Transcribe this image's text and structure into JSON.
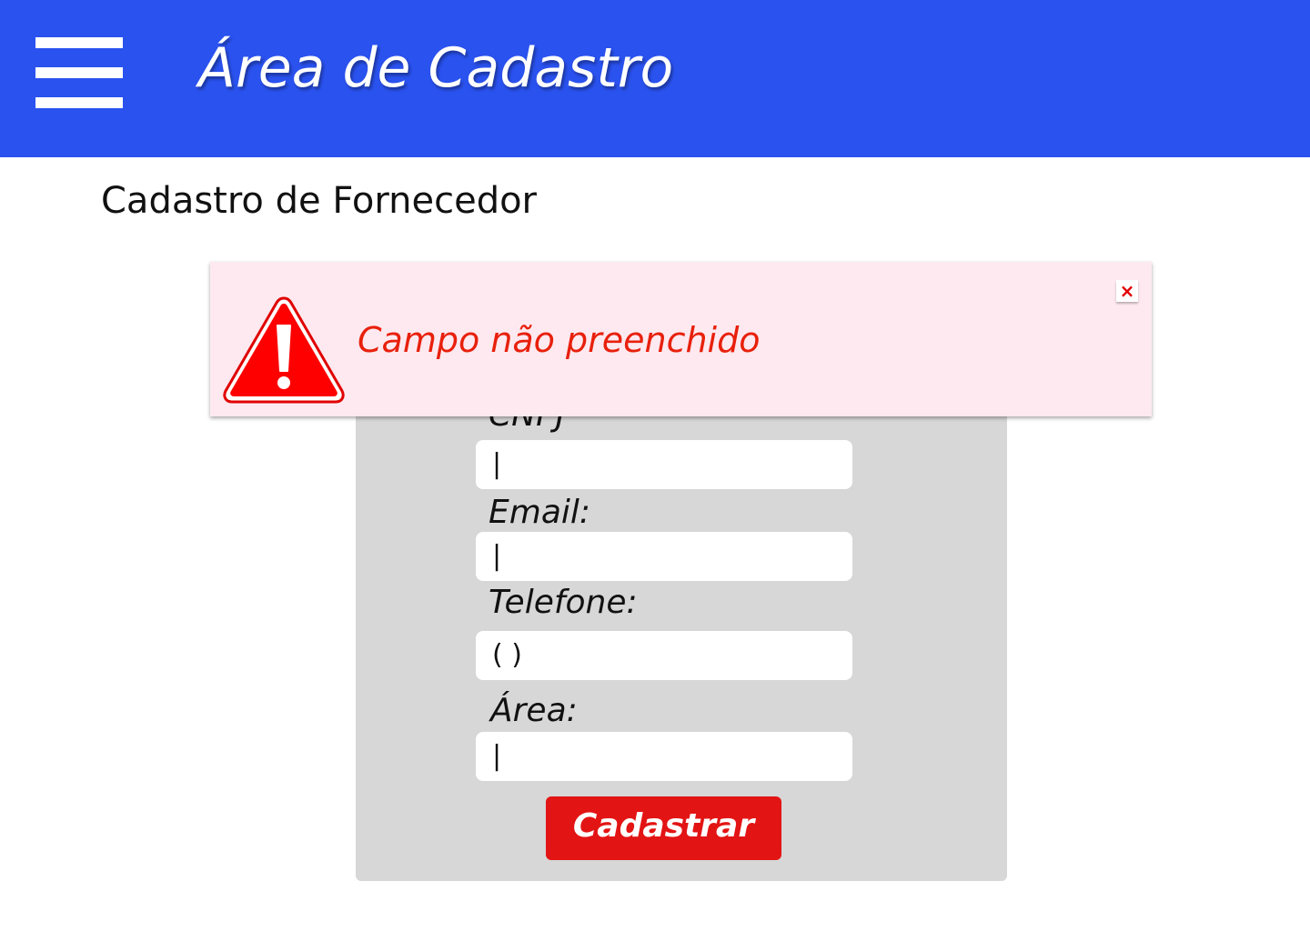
{
  "header": {
    "menu_icon": "hamburger-menu-icon",
    "title": "Área de Cadastro",
    "background_color": "#2a52ef"
  },
  "page": {
    "title": "Cadastro de Fornecedor"
  },
  "form": {
    "cnpj": {
      "label": "CNPJ",
      "value": "|"
    },
    "email": {
      "label": "Email:",
      "value": "|"
    },
    "telefone": {
      "label": "Telefone:",
      "value": "( )"
    },
    "area": {
      "label": "Área:",
      "value": "|"
    },
    "submit_label": "Cadastrar",
    "submit_color": "#e31414"
  },
  "alert": {
    "icon": "warning-triangle-icon",
    "message": "Campo não preenchido",
    "close_icon": "close-icon",
    "close_label": "×",
    "background_color": "#fde9ef",
    "text_color": "#e8200c"
  }
}
